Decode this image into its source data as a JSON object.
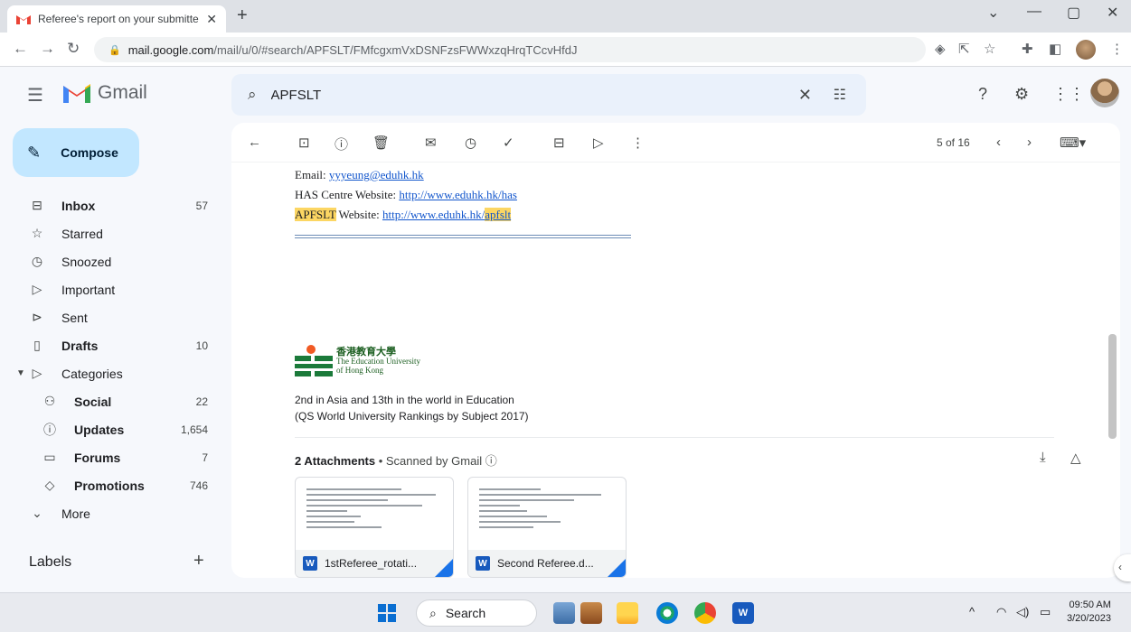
{
  "browser": {
    "tab_title": "Referee's report on your submitte",
    "url_host": "mail.google.com",
    "url_path": "/mail/u/0/#search/APFSLT/FMfcgxmVxDSNFzsFWWxzqHrqTCcvHfdJ"
  },
  "gmail": {
    "logo_text": "Gmail",
    "search_value": "APFSLT"
  },
  "sidebar": {
    "compose": "Compose",
    "items": [
      {
        "label": "Inbox",
        "count": "57"
      },
      {
        "label": "Starred",
        "count": ""
      },
      {
        "label": "Snoozed",
        "count": ""
      },
      {
        "label": "Important",
        "count": ""
      },
      {
        "label": "Sent",
        "count": ""
      },
      {
        "label": "Drafts",
        "count": "10"
      },
      {
        "label": "Categories",
        "count": ""
      },
      {
        "label": "Social",
        "count": "22"
      },
      {
        "label": "Updates",
        "count": "1,654"
      },
      {
        "label": "Forums",
        "count": "7"
      },
      {
        "label": "Promotions",
        "count": "746"
      },
      {
        "label": "More",
        "count": ""
      }
    ],
    "labels_heading": "Labels"
  },
  "message_toolbar": {
    "pager": "5 of 16"
  },
  "message": {
    "email_label": "Email: ",
    "email_link": "yyyeung@eduhk.hk",
    "has_label": "HAS Centre Website: ",
    "has_link": "http://www.eduhk.hk/has",
    "apfslt_label": "APFSLT",
    "apfslt_label_rest": " Website: ",
    "apfslt_link_base": "http://www.eduhk.hk/",
    "apfslt_link_hl": "apfslt",
    "logo_cn": "香港教育大學",
    "logo_en1": "The Education University",
    "logo_en2": "of Hong Kong",
    "rank_line1": "2nd in Asia and 13th in the world in Education",
    "rank_line2": "(QS World University Rankings by Subject 2017)"
  },
  "attachments": {
    "count_label": "2 Attachments",
    "scanned": " • Scanned by Gmail",
    "files": [
      {
        "name": "1stReferee_rotati..."
      },
      {
        "name": "Second Referee.d..."
      }
    ]
  },
  "taskbar": {
    "search": "Search",
    "time": "09:50 AM",
    "date": "3/20/2023"
  }
}
